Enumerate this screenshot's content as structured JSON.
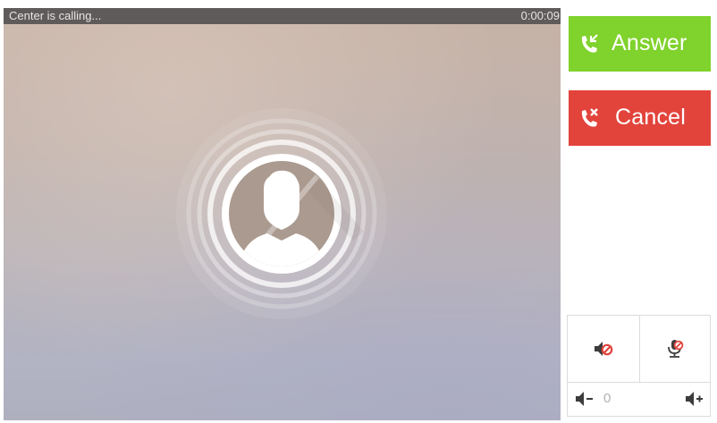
{
  "call": {
    "status_text": "Center is calling...",
    "timer": "0:00:09"
  },
  "actions": {
    "answer_label": "Answer",
    "answer_icon": "phone-incoming-icon",
    "answer_color": "#80d22c",
    "cancel_label": "Cancel",
    "cancel_icon": "phone-hangup-icon",
    "cancel_color": "#e2443c"
  },
  "controls": {
    "speaker_mute_icon": "speaker-mute-icon",
    "mic_mute_icon": "microphone-mute-icon",
    "volume_value": "0",
    "volume_down_icon": "volume-down-icon",
    "volume_up_icon": "volume-up-icon"
  },
  "avatar": {
    "icon": "user-avatar-icon"
  }
}
